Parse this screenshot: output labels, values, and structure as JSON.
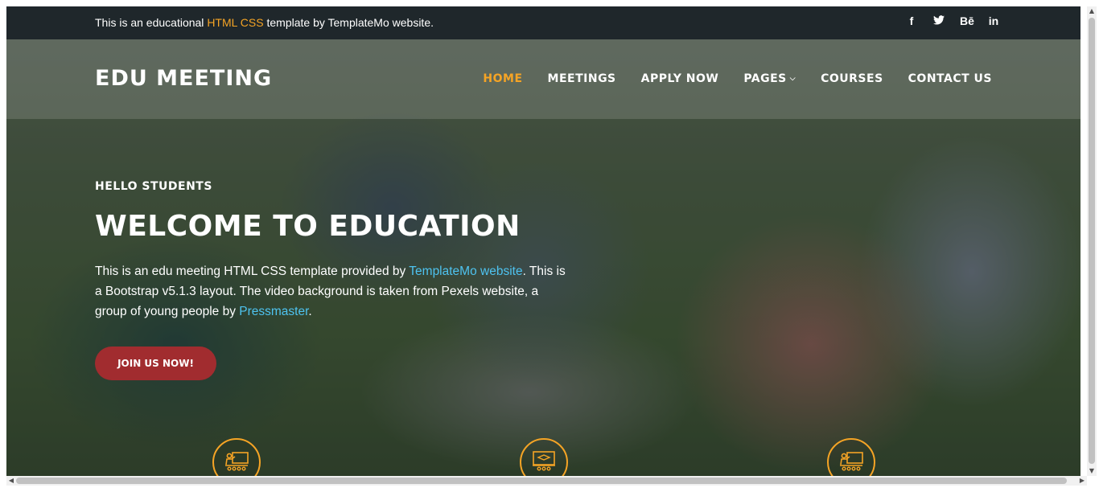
{
  "topbar": {
    "text_before": "This is an educational ",
    "text_accent": "HTML CSS",
    "text_after": " template by TemplateMo website.",
    "socials": [
      {
        "icon": "facebook-icon",
        "glyph": "f"
      },
      {
        "icon": "twitter-icon",
        "glyph": "★"
      },
      {
        "icon": "behance-icon",
        "glyph": "Bē"
      },
      {
        "icon": "linkedin-icon",
        "glyph": "in"
      }
    ]
  },
  "header": {
    "logo": "EDU MEETING",
    "nav": [
      {
        "label": "HOME",
        "active": true
      },
      {
        "label": "MEETINGS"
      },
      {
        "label": "APPLY NOW"
      },
      {
        "label": "PAGES",
        "dropdown": true
      },
      {
        "label": "COURSES"
      },
      {
        "label": "CONTACT US"
      }
    ]
  },
  "hero": {
    "subtitle": "HELLO STUDENTS",
    "title": "WELCOME TO EDUCATION",
    "desc_1": "This is an edu meeting HTML CSS template provided by ",
    "desc_link1": "TemplateMo website",
    "desc_2": ". This is a Bootstrap v5.1.3 layout. The video background is taken from Pexels website, a group of young people by ",
    "desc_link2": "Pressmaster",
    "desc_3": ".",
    "button": "JOIN US NOW!"
  },
  "services": [
    {
      "icon": "teacher-board-icon"
    },
    {
      "icon": "graduation-board-icon"
    },
    {
      "icon": "teacher-board-icon"
    }
  ],
  "colors": {
    "accent": "#f5a425",
    "button": "#a12c2f",
    "link": "#4ec3f0",
    "topbar": "#1f272b"
  }
}
